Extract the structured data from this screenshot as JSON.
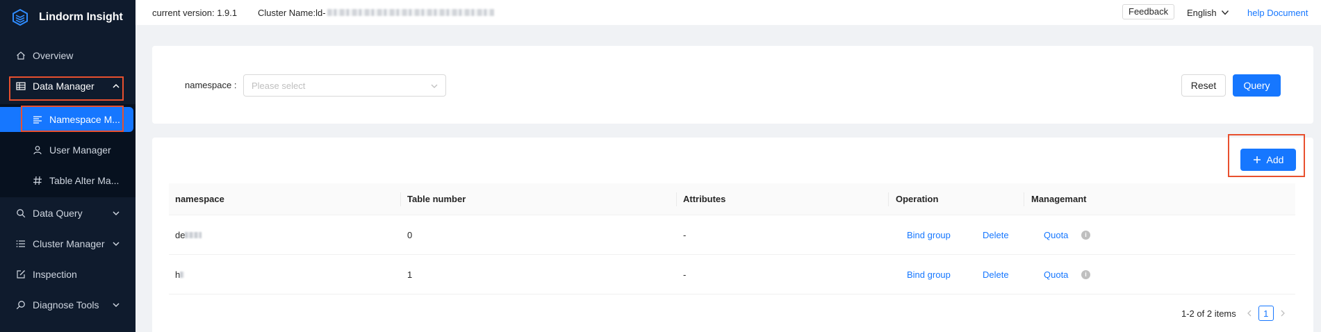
{
  "app": {
    "title": "Lindorm Insight"
  },
  "sidebar": {
    "items": [
      {
        "label": "Overview",
        "icon": "home-icon"
      },
      {
        "label": "Data Manager",
        "icon": "table-icon"
      },
      {
        "label": "Namespace M...",
        "icon": "list-icon"
      },
      {
        "label": "User Manager",
        "icon": "user-icon"
      },
      {
        "label": "Table Alter Ma...",
        "icon": "hash-icon"
      },
      {
        "label": "Data Query",
        "icon": "search-icon"
      },
      {
        "label": "Cluster Manager",
        "icon": "list-icon"
      },
      {
        "label": "Inspection",
        "icon": "edit-icon"
      },
      {
        "label": "Diagnose Tools",
        "icon": "search-icon"
      }
    ]
  },
  "header": {
    "version_label": "current version: 1.9.1",
    "cluster_label": "Cluster Name:ld-",
    "feedback": "Feedback",
    "language": "English",
    "help": "help Document"
  },
  "filter": {
    "namespace_label": "namespace :",
    "namespace_placeholder": "Please select",
    "reset": "Reset",
    "query": "Query"
  },
  "table": {
    "add_label": "Add",
    "columns": [
      "namespace",
      "Table number",
      "Attributes",
      "Operation",
      "Managemant"
    ],
    "rows": [
      {
        "namespace": "de",
        "table_number": "0",
        "attributes": "-",
        "bind": "Bind group",
        "delete": "Delete",
        "quota": "Quota"
      },
      {
        "namespace": "h",
        "table_number": "1",
        "attributes": "-",
        "bind": "Bind group",
        "delete": "Delete",
        "quota": "Quota"
      }
    ]
  },
  "pagination": {
    "summary": "1-2 of 2 items",
    "current_page": "1"
  },
  "colors": {
    "primary": "#1677ff",
    "sidebar_bg": "#0f1b2d",
    "highlight": "#e8502e"
  }
}
